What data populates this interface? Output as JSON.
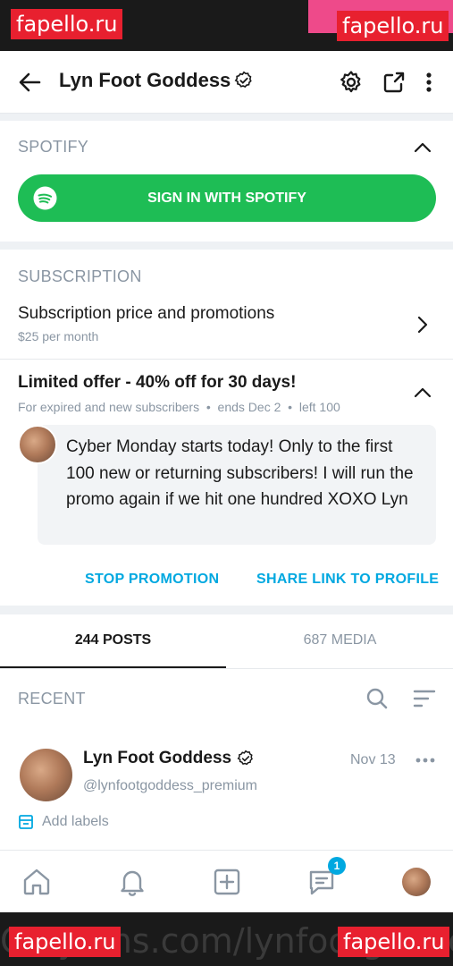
{
  "watermark": {
    "brand": "fapello.ru",
    "url": "Onlyfans.com/lynfootgoddess"
  },
  "header": {
    "title": "Lyn Foot Goddess"
  },
  "spotify": {
    "section_label": "SPOTIFY",
    "button_label": "SIGN IN WITH SPOTIFY"
  },
  "subscription": {
    "section_label": "SUBSCRIPTION",
    "row_title": "Subscription price and promotions",
    "row_sub": "$25 per month"
  },
  "offer": {
    "title": "Limited offer - 40% off for 30 days!",
    "meta": "For expired and new subscribers  •  ends Dec 2  •  left 100",
    "message": "Cyber Monday starts today! Only to the first 100 new or returning subscribers! I will run the promo again if we hit one hundred XOXO Lyn",
    "stop_label": "STOP PROMOTION",
    "share_label": "SHARE LINK TO PROFILE"
  },
  "tabs": {
    "posts": "244 POSTS",
    "media": "687 MEDIA",
    "active": "posts"
  },
  "recent": {
    "label": "RECENT"
  },
  "post": {
    "name": "Lyn Foot Goddess",
    "handle": "@lynfootgoddess_premium",
    "date": "Nov 13",
    "add_labels": "Add labels"
  },
  "bottom_nav": {
    "messages_badge": "1"
  },
  "colors": {
    "accent": "#00a8e0",
    "spotify_green": "#1ebd55",
    "muted": "#8a96a3"
  }
}
